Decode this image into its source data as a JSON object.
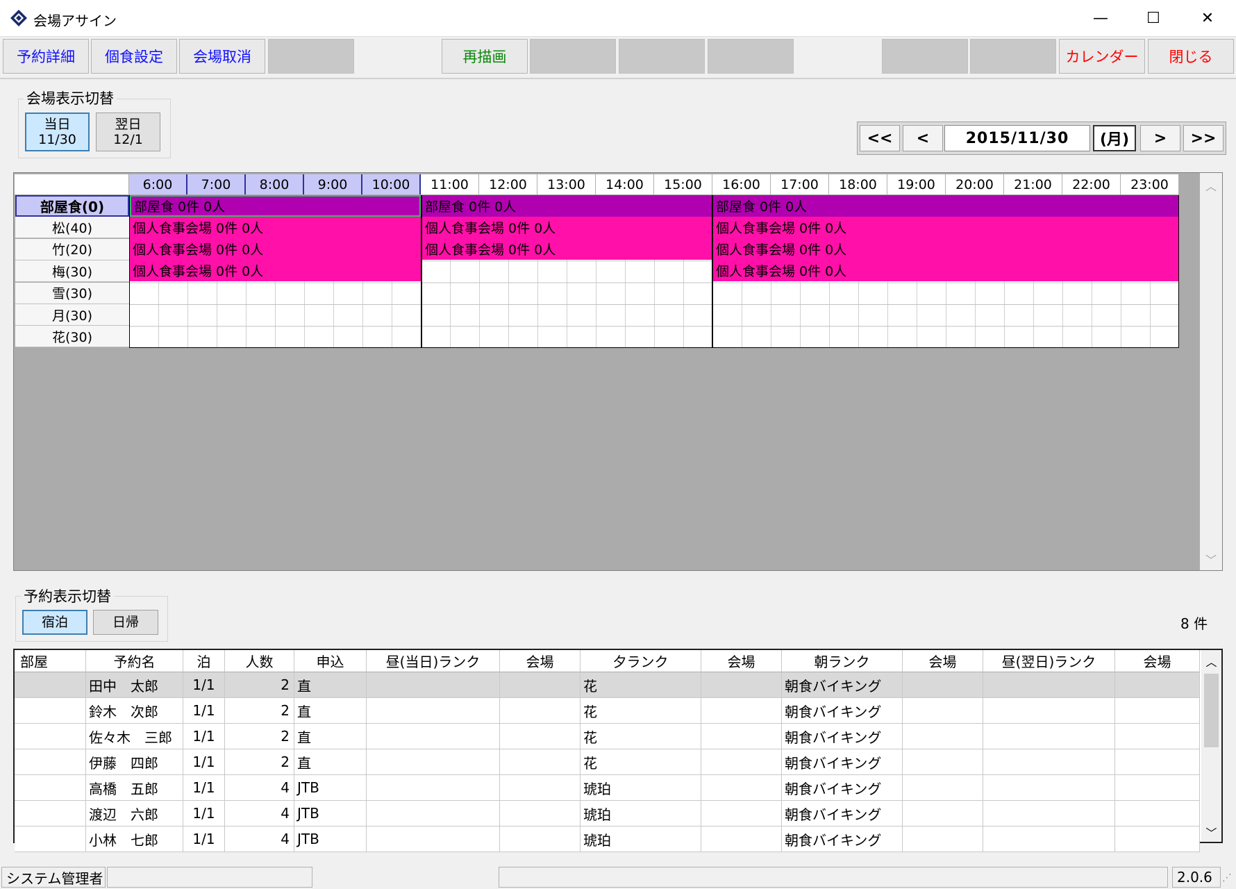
{
  "window": {
    "title": "会場アサイン",
    "minimize": "—",
    "maximize": "☐",
    "close": "✕"
  },
  "toolbar": {
    "reservation_detail": "予約詳細",
    "meal_settings": "個食設定",
    "venue_cancel": "会場取消",
    "redraw": "再描画",
    "calendar": "カレンダー",
    "close": "閉じる"
  },
  "venue_toggle": {
    "label": "会場表示切替",
    "today_line1": "当日",
    "today_line2": "11/30",
    "next_line1": "翌日",
    "next_line2": "12/1"
  },
  "date_nav": {
    "first": "<<",
    "prev": "<",
    "date": "2015/11/30",
    "weekday": "(月)",
    "next": ">",
    "last": ">>"
  },
  "schedule": {
    "hours": [
      "6:00",
      "7:00",
      "8:00",
      "9:00",
      "10:00",
      "11:00",
      "12:00",
      "13:00",
      "14:00",
      "15:00",
      "16:00",
      "17:00",
      "18:00",
      "19:00",
      "20:00",
      "21:00",
      "22:00",
      "23:00"
    ],
    "rooms": [
      "部屋食(0)",
      "松(40)",
      "竹(20)",
      "梅(30)",
      "雪(30)",
      "月(30)",
      "花(30)"
    ],
    "block_room": "部屋食 0件 0人",
    "block_private": "個人食事会場 0件 0人"
  },
  "reservation_toggle": {
    "label": "予約表示切替",
    "stay": "宿泊",
    "daytrip": "日帰",
    "count": "8 件"
  },
  "table": {
    "headers": [
      "部屋",
      "予約名",
      "泊",
      "人数",
      "申込",
      "昼(当日)ランク",
      "会場",
      "夕ランク",
      "会場",
      "朝ランク",
      "会場",
      "昼(翌日)ランク",
      "会場"
    ],
    "rows": [
      [
        "",
        "田中　太郎",
        "1/1",
        "2",
        "直",
        "",
        "",
        "花",
        "",
        "朝食バイキング",
        "",
        "",
        ""
      ],
      [
        "",
        "鈴木　次郎",
        "1/1",
        "2",
        "直",
        "",
        "",
        "花",
        "",
        "朝食バイキング",
        "",
        "",
        ""
      ],
      [
        "",
        "佐々木　三郎",
        "1/1",
        "2",
        "直",
        "",
        "",
        "花",
        "",
        "朝食バイキング",
        "",
        "",
        ""
      ],
      [
        "",
        "伊藤　四郎",
        "1/1",
        "2",
        "直",
        "",
        "",
        "花",
        "",
        "朝食バイキング",
        "",
        "",
        ""
      ],
      [
        "",
        "高橋　五郎",
        "1/1",
        "4",
        "JTB",
        "",
        "",
        "琥珀",
        "",
        "朝食バイキング",
        "",
        "",
        ""
      ],
      [
        "",
        "渡辺　六郎",
        "1/1",
        "4",
        "JTB",
        "",
        "",
        "琥珀",
        "",
        "朝食バイキング",
        "",
        "",
        ""
      ],
      [
        "",
        "小林　七郎",
        "1/1",
        "4",
        "JTB",
        "",
        "",
        "琥珀",
        "",
        "朝食バイキング",
        "",
        "",
        ""
      ]
    ]
  },
  "status": {
    "user": "システム管理者",
    "version": "2.0.6"
  }
}
